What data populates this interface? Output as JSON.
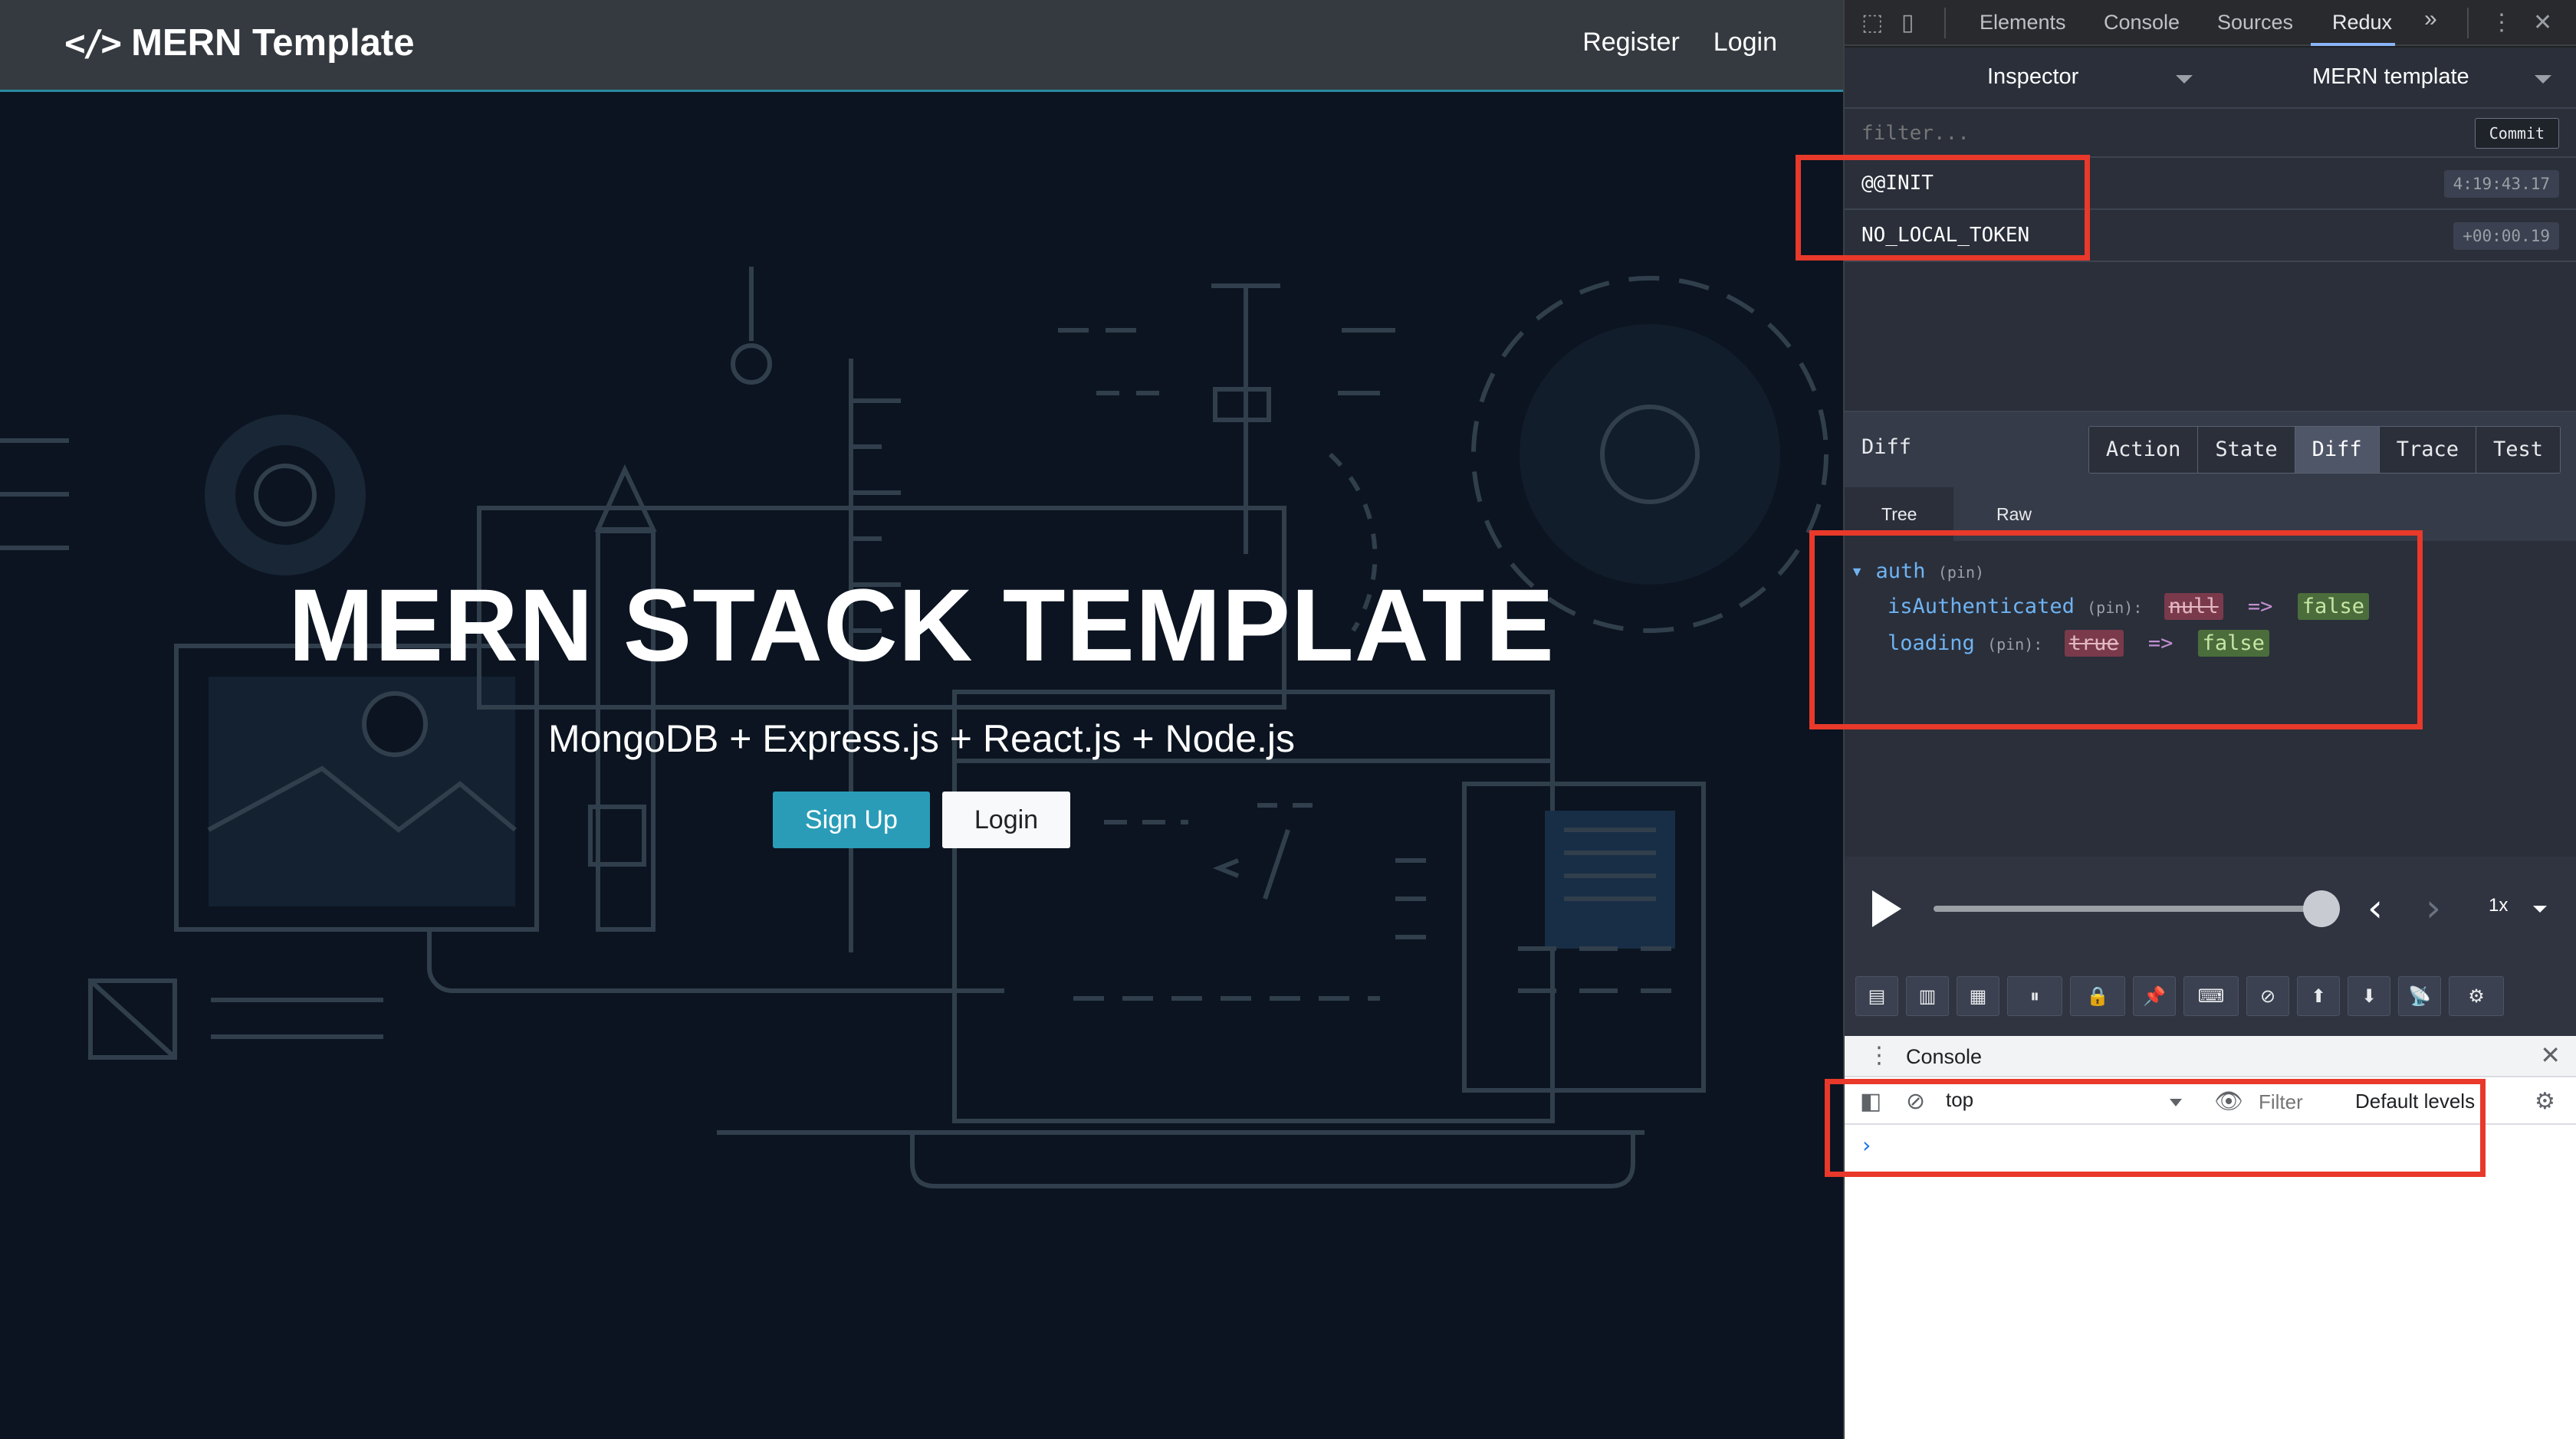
{
  "app": {
    "brand": "MERN Template",
    "brand_icon": "</>",
    "nav": {
      "register": "Register",
      "login": "Login"
    },
    "hero": {
      "title": "MERN STACK TEMPLATE",
      "subtitle": "MongoDB + Express.js + React.js + Node.js",
      "signup_button": "Sign Up",
      "login_button": "Login"
    },
    "colors": {
      "navbar": "#353a40",
      "primary_button": "#2a9cb8",
      "hero_bg": "#0b1420"
    }
  },
  "devtools": {
    "tabs": [
      "Elements",
      "Console",
      "Sources",
      "Redux"
    ],
    "active_tab": "Redux",
    "more_tabs": "»",
    "redux": {
      "inspector_label": "Inspector",
      "instance_label": "MERN template",
      "filter_placeholder": "filter...",
      "commit_label": "Commit",
      "actions": [
        {
          "name": "@@INIT",
          "time": "4:19:43.17"
        },
        {
          "name": "NO_LOCAL_TOKEN",
          "time": "+00:00.19"
        }
      ],
      "monitor_title": "Diff",
      "monitor_tabs": [
        "Action",
        "State",
        "Diff",
        "Trace",
        "Test"
      ],
      "active_monitor_tab": "Diff",
      "sub_tabs": [
        "Tree",
        "Raw"
      ],
      "active_sub_tab": "Tree",
      "diff": {
        "root_key": "auth",
        "pin_label": "(pin)",
        "rows": [
          {
            "key": "isAuthenticated",
            "pin": "(pin):",
            "old": "null",
            "arrow": "=>",
            "new": "false"
          },
          {
            "key": "loading",
            "pin": "(pin):",
            "old": "true",
            "arrow": "=>",
            "new": "false"
          }
        ]
      },
      "slider": {
        "position": 1.0,
        "speed": "1x"
      }
    },
    "console": {
      "title": "Console",
      "context": "top",
      "filter_placeholder": "Filter",
      "levels": "Default levels",
      "prompt": "›"
    }
  }
}
